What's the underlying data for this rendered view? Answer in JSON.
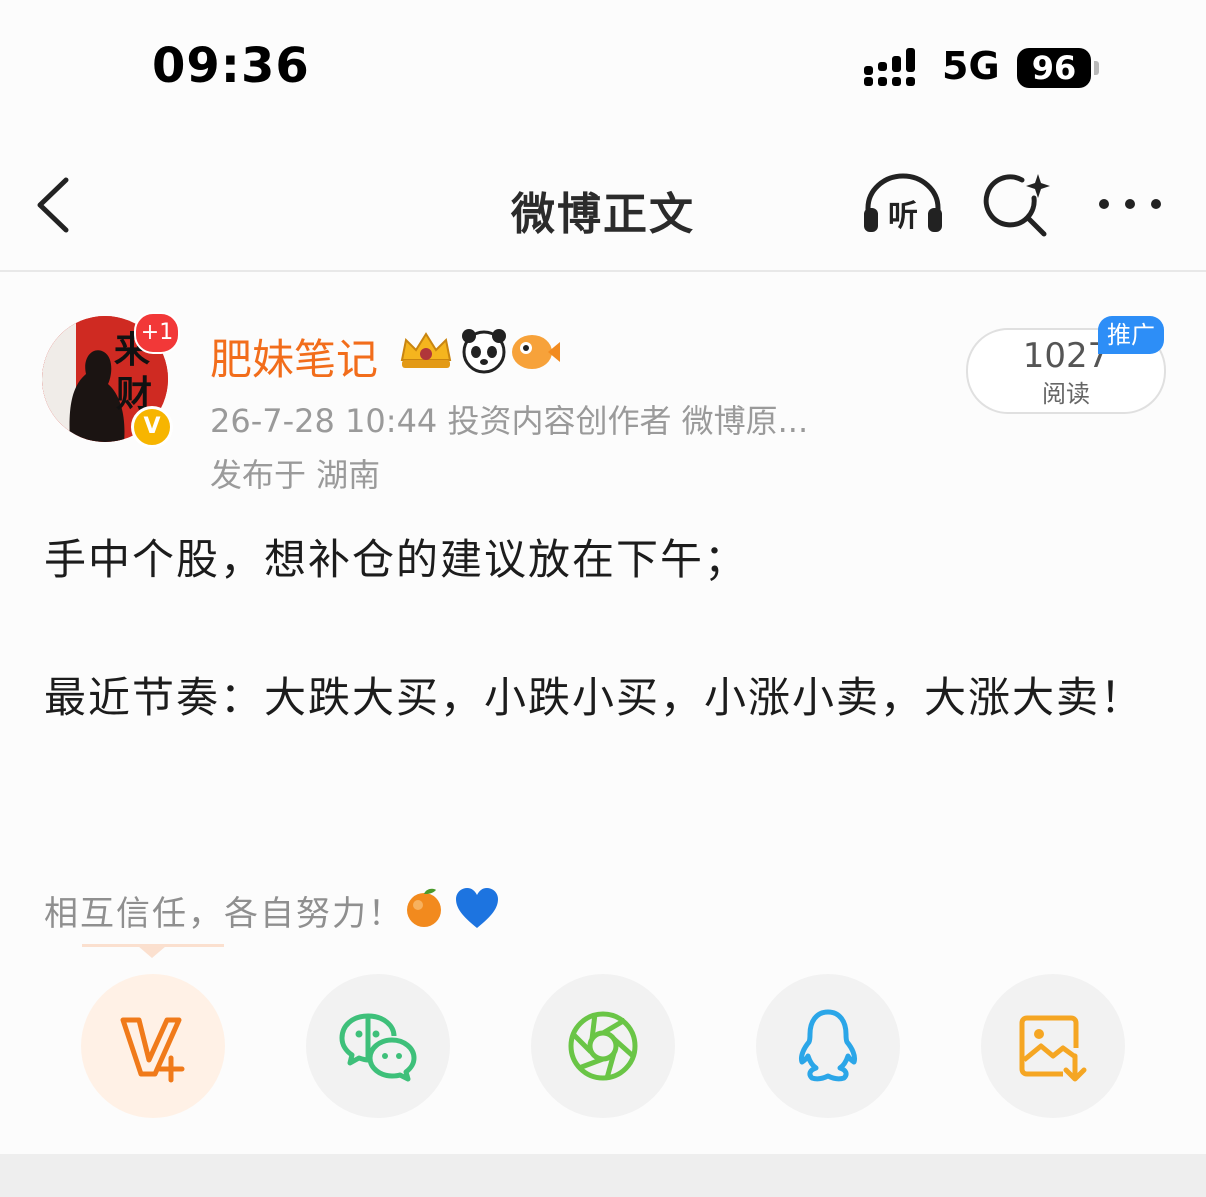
{
  "status_bar": {
    "time": "09:36",
    "network": "5G",
    "battery": "96"
  },
  "nav": {
    "title": "微博正文",
    "listen_icon_text": "听"
  },
  "author": {
    "avatar_text_1": "来",
    "avatar_text_2": "财",
    "avatar_badge": "+1",
    "verified_mark": "V",
    "name": "肥妹笔记",
    "meta": "26-7-28 10:44  投资内容创作者 微博原...",
    "location": "发布于 湖南"
  },
  "reads": {
    "count": "1027",
    "label": "阅读",
    "promo_tag": "推广"
  },
  "post": {
    "line1": "手中个股，想补仓的建议放在下午；",
    "line2": "最近节奏：大跌大买，小跌小买，小涨小卖，大涨大卖！",
    "signature": "相互信任，各自努力！"
  },
  "share": {
    "items": [
      "vplus-icon",
      "wechat-icon",
      "moments-icon",
      "qq-icon",
      "save-image-icon"
    ]
  },
  "colors": {
    "accent": "#f26d1b",
    "wechat": "#3ec07a",
    "moments": "#6ac546",
    "qq": "#2ba6e8",
    "save": "#f5a623"
  }
}
